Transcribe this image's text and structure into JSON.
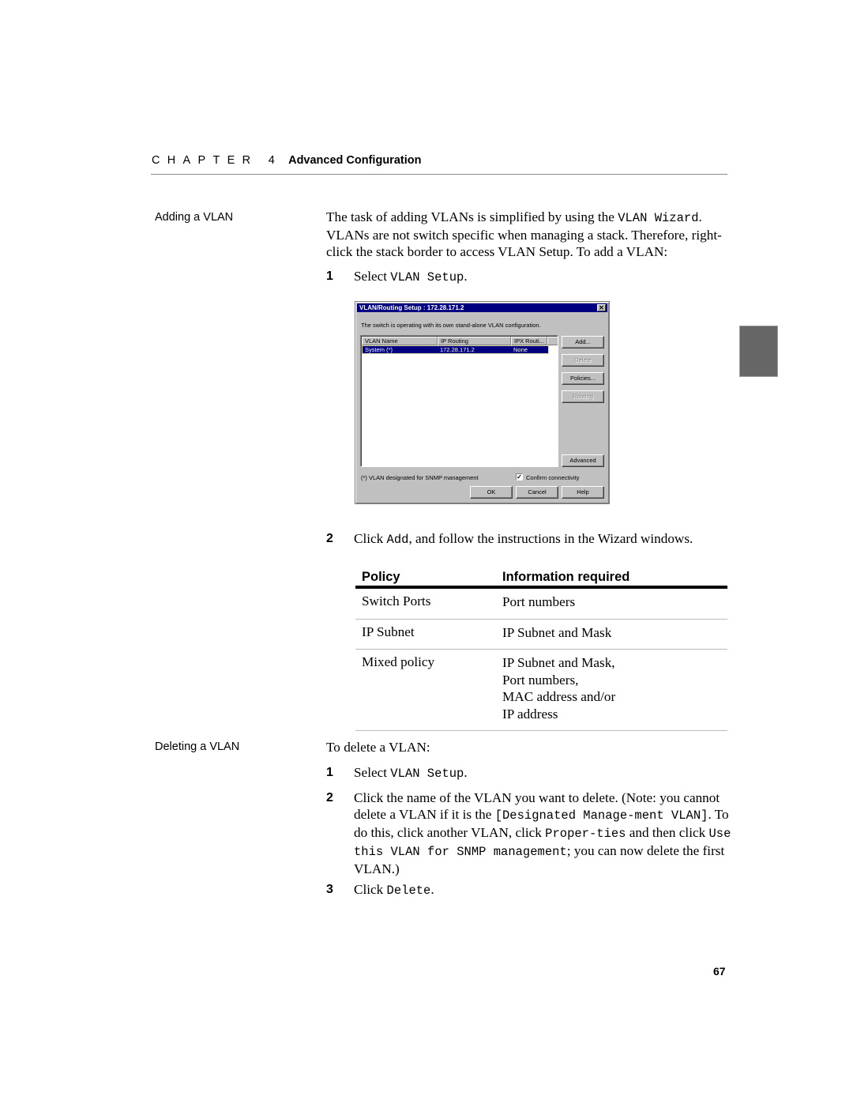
{
  "header": {
    "chapter_label": "CHAPTER 4",
    "chapter_title": "Advanced Configuration"
  },
  "sections": {
    "adding": {
      "side_label": "Adding a VLAN",
      "intro_parts": [
        "The task of adding VLANs is simplified by using the ",
        "VLAN Wizard",
        ". VLANs are not switch specific when managing a stack. Therefore, right-click the stack border to access VLAN Setup. To add a VLAN:"
      ],
      "step1": {
        "num": "1",
        "pre": "Select ",
        "code": "VLAN Setup",
        "post": "."
      },
      "step2": {
        "num": "2",
        "pre": "Click ",
        "code": "Add",
        "post": ", and follow the instructions in the Wizard windows."
      }
    },
    "deleting": {
      "side_label": "Deleting a VLAN",
      "intro": "To delete a VLAN:",
      "step1": {
        "num": "1",
        "pre": "Select ",
        "code": "VLAN Setup",
        "post": "."
      },
      "step2": {
        "num": "2",
        "t1": "Click the name of the VLAN you want to delete. (Note: you cannot delete a VLAN if it is the ",
        "c1": "[Designated Manage-ment VLAN]",
        "t2": ". To do this, click another VLAN, click ",
        "c2": "Proper-ties",
        "t3": " and then click ",
        "c3": "Use this VLAN for SNMP management",
        "t4": "; you can now delete the first VLAN.)"
      },
      "step3": {
        "num": "3",
        "pre": "Click ",
        "code": "Delete",
        "post": "."
      }
    }
  },
  "dialog": {
    "title": "VLAN/Routing Setup : 172.28.171.2",
    "close_glyph": "✕",
    "message": "The switch is operating with its own stand-alone VLAN configuration.",
    "columns": [
      "VLAN Name",
      "IP Routing",
      "IPX Routi..."
    ],
    "rows": [
      {
        "name": "System (*)",
        "ip_routing": "172.28.171.2",
        "ipx_routing": "None",
        "selected": true
      }
    ],
    "buttons": {
      "add": "Add...",
      "delete": "Delete",
      "policies": "Policies...",
      "routing": "Routing",
      "advanced": "Advanced",
      "ok": "OK",
      "cancel": "Cancel",
      "help": "Help"
    },
    "footnote": "(*) VLAN designated for SNMP management",
    "confirm_checkbox": {
      "label": "Confirm connectivity",
      "checked": true,
      "glyph": "✓"
    }
  },
  "policy_table": {
    "headers": [
      "Policy",
      "Information required"
    ],
    "rows": [
      {
        "policy": "Switch Ports",
        "info": [
          "Port numbers"
        ]
      },
      {
        "policy": "IP Subnet",
        "info": [
          "IP Subnet and Mask"
        ]
      },
      {
        "policy": "Mixed policy",
        "info": [
          "IP Subnet and Mask,",
          "Port numbers,",
          "MAC address and/or",
          "IP address"
        ]
      }
    ]
  },
  "footer": {
    "page_number": "67"
  },
  "colors": {
    "side_tab": "#666666",
    "dialog_title_bar": "#000080",
    "dialog_face": "#c0c0c0"
  }
}
